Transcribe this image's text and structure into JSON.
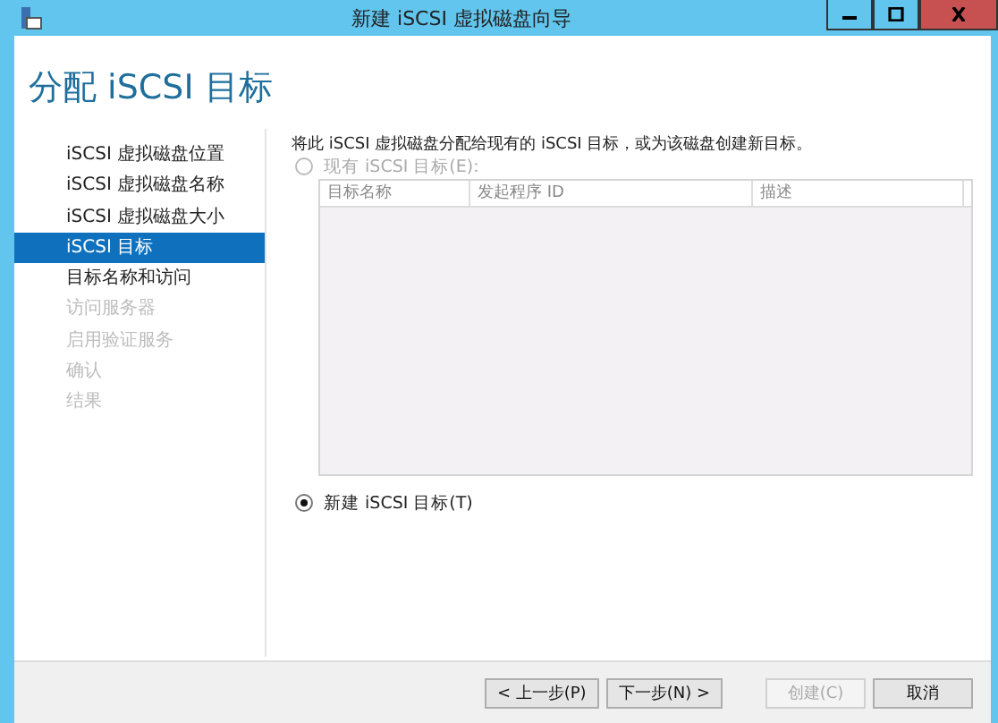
{
  "window": {
    "title": "新建 iSCSI 虚拟磁盘向导"
  },
  "page_title": "分配 iSCSI 目标",
  "steps": [
    {
      "label": "iSCSI 虚拟磁盘位置",
      "selected": false,
      "disabled": false
    },
    {
      "label": "iSCSI 虚拟磁盘名称",
      "selected": false,
      "disabled": false
    },
    {
      "label": "iSCSI 虚拟磁盘大小",
      "selected": false,
      "disabled": false
    },
    {
      "label": "iSCSI 目标",
      "selected": true,
      "disabled": false
    },
    {
      "label": "目标名称和访问",
      "selected": false,
      "disabled": false
    },
    {
      "label": "访问服务器",
      "selected": false,
      "disabled": true
    },
    {
      "label": "启用验证服务",
      "selected": false,
      "disabled": true
    },
    {
      "label": "确认",
      "selected": false,
      "disabled": true
    },
    {
      "label": "结果",
      "selected": false,
      "disabled": true
    }
  ],
  "instruction": "将此 iSCSI 虚拟磁盘分配给现有的 iSCSI 目标，或为该磁盘创建新目标。",
  "options": [
    {
      "label": "现有 iSCSI 目标(E):",
      "selected": false,
      "disabled": true
    },
    {
      "label": "新建 iSCSI 目标(T)",
      "selected": true,
      "disabled": false
    }
  ],
  "table": {
    "columns": [
      "目标名称",
      "发起程序 ID",
      "描述"
    ]
  },
  "buttons": [
    {
      "label": "< 上一步(P)",
      "disabled": false
    },
    {
      "label": "下一步(N) >",
      "disabled": false
    },
    {
      "label": "创建(C)",
      "disabled": true
    },
    {
      "label": "取消",
      "disabled": false
    }
  ]
}
